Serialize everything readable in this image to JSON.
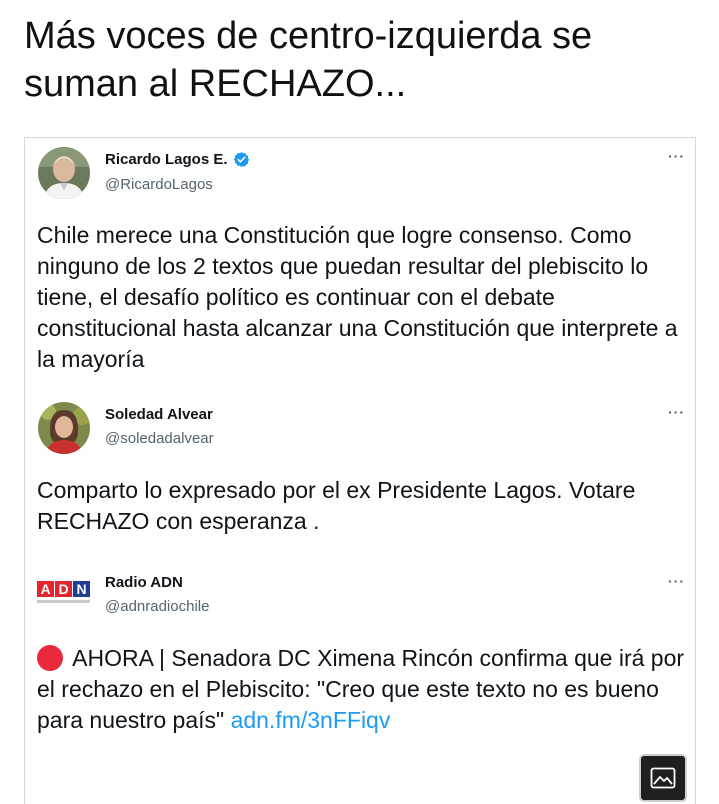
{
  "headline": "Más voces de centro-izquierda se suman al RECHAZO...",
  "tweets": [
    {
      "name": "Ricardo Lagos E.",
      "handle": "@RicardoLagos",
      "verified": true,
      "more": "···",
      "text": "Chile merece una Constitución que logre consenso. Como ninguno de los 2 textos que puedan resultar del plebiscito lo tiene, el desafío político es continuar con el debate constitucional hasta alcanzar una Constitución que interprete a la mayoría"
    },
    {
      "name": "Soledad Alvear",
      "handle": "@soledadalvear",
      "verified": false,
      "more": "···",
      "text": "Comparto lo expresado por el ex Presidente Lagos. Votare RECHAZO con esperanza ."
    },
    {
      "name": "Radio ADN",
      "handle": "@adnradiochile",
      "verified": false,
      "more": "···",
      "logo_text": "ADN",
      "text": "AHORA | Senadora DC Ximena Rincón confirma que irá por el rechazo en el Plebiscito: \"Creo que este texto no es bueno para nuestro país\"",
      "link": "adn.fm/3nFFiqv"
    }
  ],
  "icons": {
    "verified": "verified-badge-icon",
    "more": "more-options-icon",
    "alert": "red-circle-icon",
    "media": "image-icon"
  },
  "colors": {
    "link": "#1d9bf0",
    "verified": "#1d9bf0",
    "alert": "#ea2a3c",
    "adn_red": "#e3262e",
    "adn_blue": "#1e3f8f"
  }
}
